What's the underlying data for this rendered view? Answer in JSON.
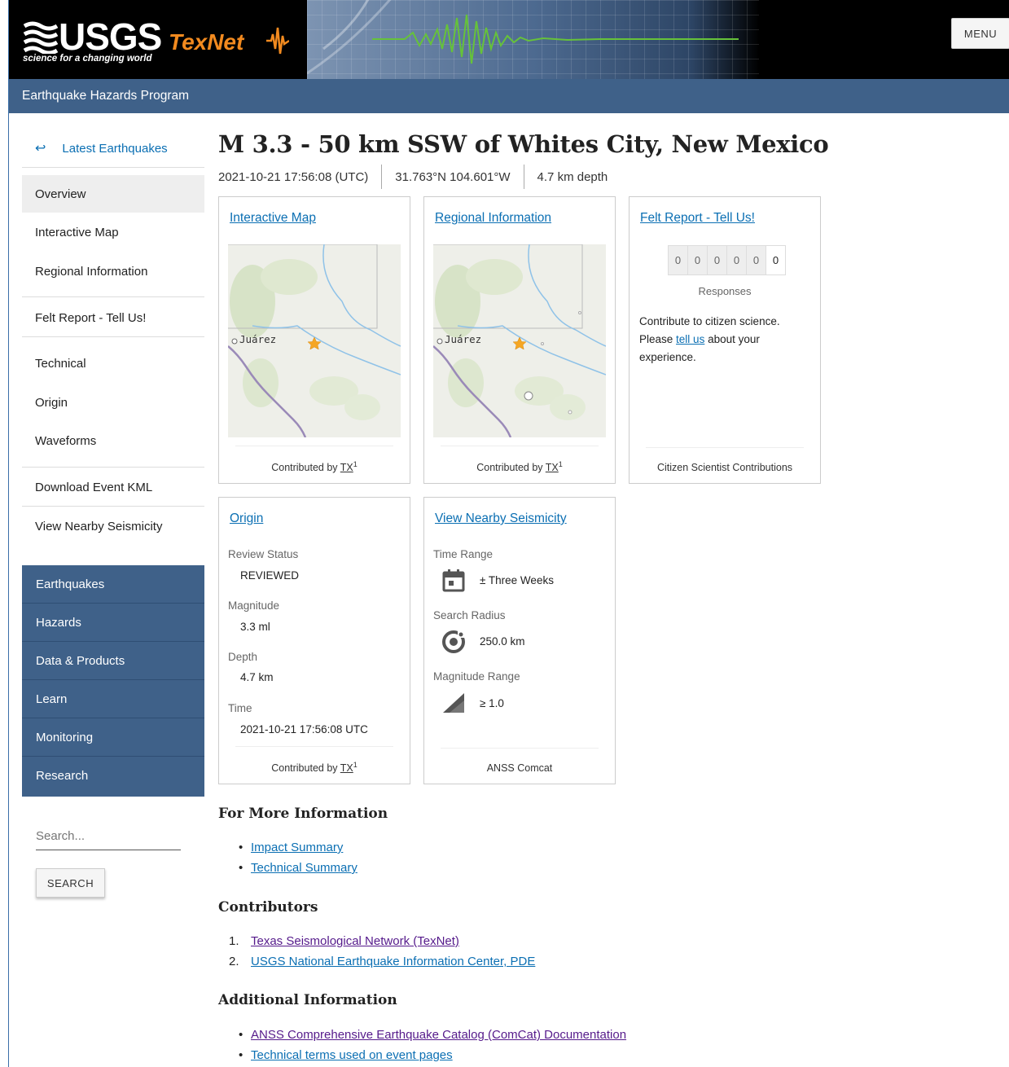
{
  "header": {
    "logo_word": "USGS",
    "logo_tagline": "science for a changing world",
    "partner": "TexNet",
    "menu_label": "MENU",
    "program": "Earthquake Hazards Program"
  },
  "sidebar": {
    "back_label": "Latest Earthquakes",
    "links": {
      "overview": "Overview",
      "interactive_map": "Interactive Map",
      "regional_information": "Regional Information",
      "felt_report": "Felt Report - Tell Us!",
      "technical": "Technical",
      "origin": "Origin",
      "waveforms": "Waveforms",
      "download_kml": "Download Event KML",
      "nearby_seismicity": "View Nearby Seismicity"
    },
    "nav": [
      "Earthquakes",
      "Hazards",
      "Data & Products",
      "Learn",
      "Monitoring",
      "Research"
    ],
    "search_placeholder": "Search...",
    "search_button": "SEARCH"
  },
  "event": {
    "title": "M 3.3 - 50 km SSW of Whites City, New Mexico",
    "time": "2021-10-21 17:56:08 (UTC)",
    "location": "31.763°N 104.601°W",
    "depth": "4.7 km depth"
  },
  "cards": {
    "interactive_map": {
      "title": "Interactive Map",
      "map_label": "Juárez",
      "contributed_prefix": "Contributed by",
      "contributor": "TX",
      "sup": "1"
    },
    "regional": {
      "title": "Regional Information",
      "map_label": "Juárez",
      "contributed_prefix": "Contributed by",
      "contributor": "TX",
      "sup": "1"
    },
    "felt": {
      "title": "Felt Report - Tell Us!",
      "digits": [
        "0",
        "0",
        "0",
        "0",
        "0",
        "0"
      ],
      "responses_label": "Responses",
      "text_before": "Contribute to citizen science. Please",
      "link": "tell us",
      "text_after": "about your experience.",
      "footer": "Citizen Scientist Contributions"
    },
    "origin": {
      "title": "Origin",
      "review_status_label": "Review Status",
      "review_status": "REVIEWED",
      "magnitude_label": "Magnitude",
      "magnitude": "3.3 ml",
      "depth_label": "Depth",
      "depth": "4.7 km",
      "time_label": "Time",
      "time": "2021-10-21 17:56:08 UTC",
      "contributed_prefix": "Contributed by",
      "contributor": "TX",
      "sup": "1"
    },
    "nearby": {
      "title": "View Nearby Seismicity",
      "time_range_label": "Time Range",
      "time_range": "± Three Weeks",
      "radius_label": "Search Radius",
      "radius": "250.0 km",
      "magnitude_range_label": "Magnitude Range",
      "magnitude_range": "≥ 1.0",
      "footer": "ANSS Comcat",
      "icons": [
        "calendar-icon",
        "target-icon",
        "ramp-icon"
      ]
    }
  },
  "more_info": {
    "heading": "For More Information",
    "links": [
      "Impact Summary",
      "Technical Summary"
    ]
  },
  "contributors": {
    "heading": "Contributors",
    "items": [
      "Texas Seismological Network (TexNet)",
      "USGS National Earthquake Information Center, PDE"
    ]
  },
  "additional": {
    "heading": "Additional Information",
    "links": [
      "ANSS Comprehensive Earthquake Catalog (ComCat) Documentation",
      "Technical terms used on event pages"
    ]
  },
  "colors": {
    "link": "#0b6fb3",
    "visited": "#551a8b",
    "nav_blue": "#3f6189",
    "texnet_orange": "#f28a1f",
    "star": "#f5a623"
  }
}
